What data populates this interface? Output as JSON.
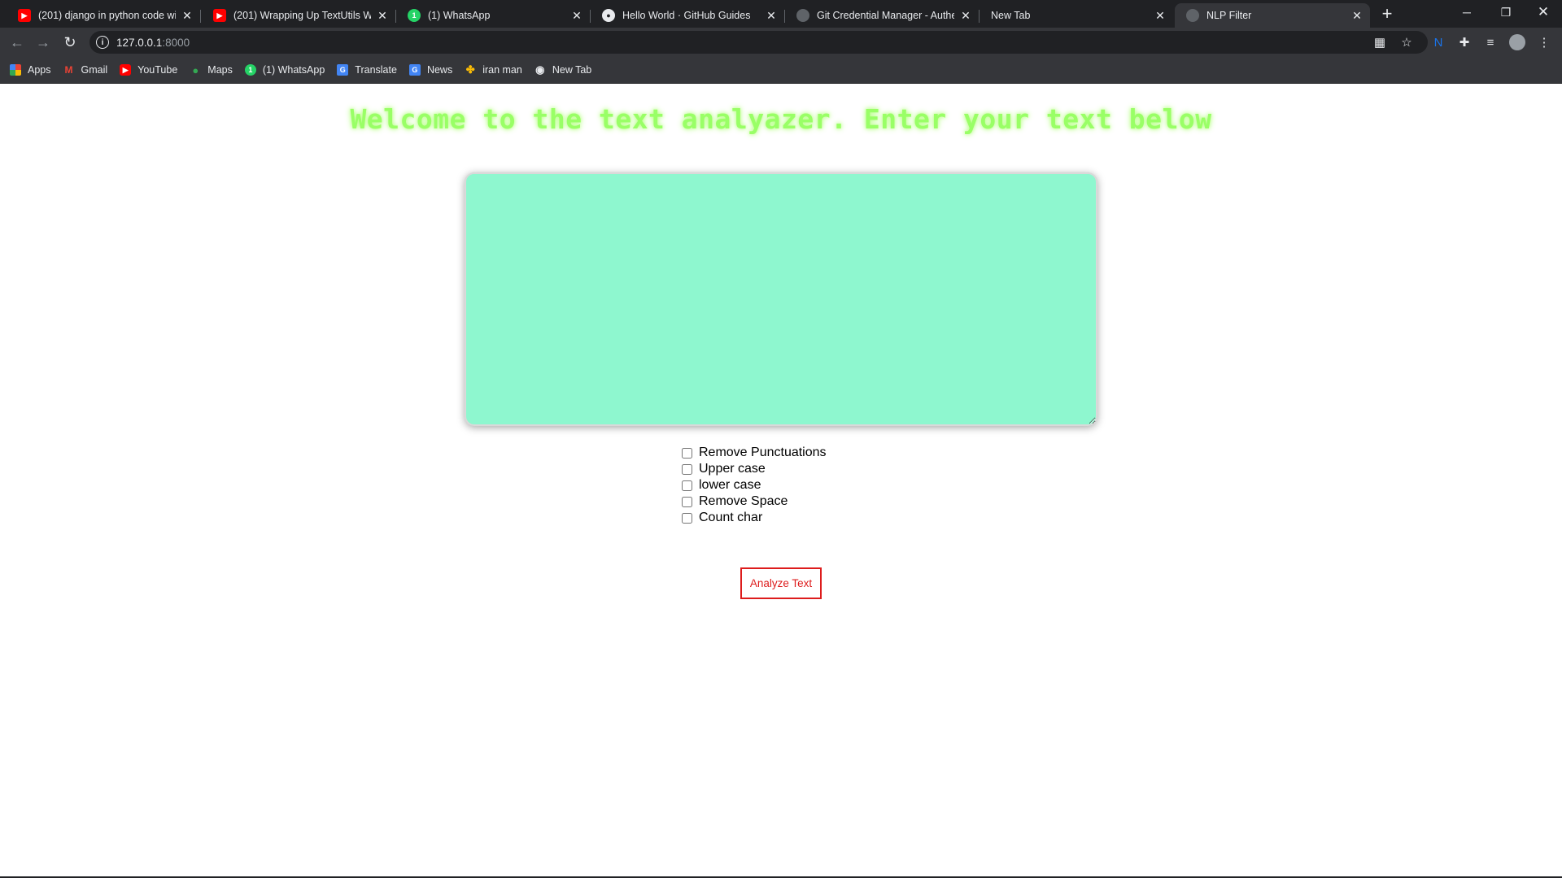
{
  "tabs": [
    {
      "title": "(201) django in python code with",
      "favicon": "youtube-icon",
      "color": "#ff0000"
    },
    {
      "title": "(201) Wrapping Up TextUtils Wel",
      "favicon": "youtube-icon",
      "color": "#ff0000"
    },
    {
      "title": "(1) WhatsApp",
      "favicon": "whatsapp-icon",
      "color": "#25d366"
    },
    {
      "title": "Hello World · GitHub Guides",
      "favicon": "github-icon",
      "color": "#e8eaed"
    },
    {
      "title": "Git Credential Manager - Authen",
      "favicon": "globe-icon",
      "color": "#5f6368"
    },
    {
      "title": "New Tab",
      "favicon": "",
      "color": ""
    },
    {
      "title": "NLP Filter",
      "favicon": "globe-icon",
      "color": "#5f6368",
      "active": true
    }
  ],
  "address": {
    "host": "127.0.0.1",
    "port": ":8000"
  },
  "bookmarks": [
    {
      "label": "Apps",
      "icon": "apps-grid-icon"
    },
    {
      "label": "Gmail",
      "icon": "gmail-icon"
    },
    {
      "label": "YouTube",
      "icon": "youtube-icon"
    },
    {
      "label": "Maps",
      "icon": "maps-icon"
    },
    {
      "label": "(1) WhatsApp",
      "icon": "whatsapp-icon"
    },
    {
      "label": "Translate",
      "icon": "translate-icon"
    },
    {
      "label": "News",
      "icon": "news-icon"
    },
    {
      "label": "iran man",
      "icon": "pinwheel-icon"
    },
    {
      "label": "New Tab",
      "icon": "globe-icon"
    }
  ],
  "page": {
    "heading": "Welcome to the text analyazer. Enter your text below",
    "textarea_value": "",
    "options": [
      {
        "label": "Remove Punctuations",
        "checked": false
      },
      {
        "label": "Upper case",
        "checked": false
      },
      {
        "label": "lower case",
        "checked": false
      },
      {
        "label": "Remove Space",
        "checked": false
      },
      {
        "label": "Count char",
        "checked": false
      }
    ],
    "submit_label": "Analyze Text"
  },
  "colors": {
    "heading": "#99ff66",
    "textarea_bg": "#8ef7cf",
    "button_accent": "#dd1c1c"
  }
}
